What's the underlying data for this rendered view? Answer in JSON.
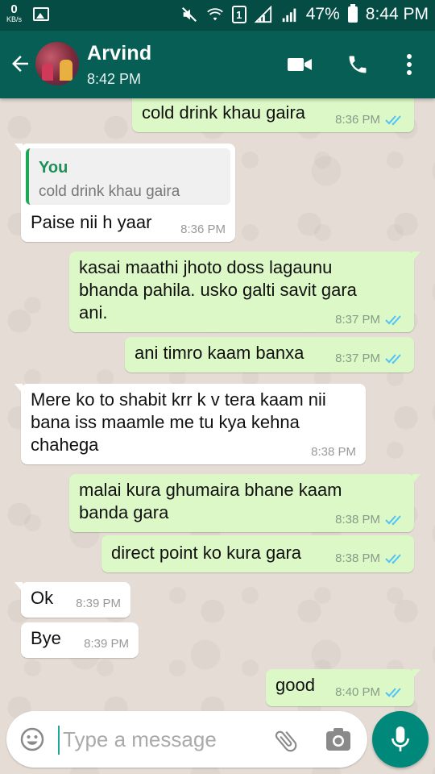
{
  "status_bar": {
    "kbs_value": "0",
    "kbs_unit": "KB/s",
    "sim_number": "1",
    "battery": "47%",
    "time": "8:44 PM"
  },
  "header": {
    "contact_name": "Arvind",
    "last_seen": "8:42 PM"
  },
  "messages": [
    {
      "direction": "out",
      "text": "cold drink khau gaira",
      "time": "8:36 PM",
      "status": "read"
    },
    {
      "direction": "in",
      "quote_author": "You",
      "quote_text": "cold drink khau gaira",
      "text": "Paise nii h yaar",
      "time": "8:36 PM"
    },
    {
      "direction": "out",
      "lines": [
        "kasai maathi jhoto doss lagaunu",
        "bhanda pahila. usko galti savit gara",
        "ani."
      ],
      "time": "8:37 PM",
      "status": "read"
    },
    {
      "direction": "out",
      "text": "ani timro kaam banxa",
      "time": "8:37 PM",
      "status": "read"
    },
    {
      "direction": "in",
      "lines": [
        "Mere ko to shabit krr k v tera kaam nii",
        "bana iss maamle me tu kya kehna",
        "chahega"
      ],
      "time": "8:38 PM"
    },
    {
      "direction": "out",
      "lines": [
        "malai kura ghumaira bhane kaam",
        "banda gara"
      ],
      "time": "8:38 PM",
      "status": "read"
    },
    {
      "direction": "out",
      "text": "direct point ko kura gara",
      "time": "8:38 PM",
      "status": "read"
    },
    {
      "direction": "in",
      "text": "Ok",
      "time": "8:39 PM"
    },
    {
      "direction": "in",
      "text": "Bye",
      "time": "8:39 PM"
    },
    {
      "direction": "out",
      "text": "good",
      "time": "8:40 PM",
      "status": "read"
    }
  ],
  "input": {
    "placeholder": "Type a message"
  },
  "colors": {
    "header": "#075e54",
    "status_bar": "#054d44",
    "outgoing_bubble": "#dcf8c6",
    "incoming_bubble": "#ffffff",
    "read_ticks": "#4fc3f7",
    "mic_button": "#00897b"
  },
  "icons": {
    "back": "arrow-left-icon",
    "video": "video-camera-icon",
    "call": "phone-icon",
    "menu": "more-vert-icon",
    "emoji": "smiley-icon",
    "attach": "paperclip-icon",
    "camera": "camera-icon",
    "mic": "microphone-icon"
  }
}
